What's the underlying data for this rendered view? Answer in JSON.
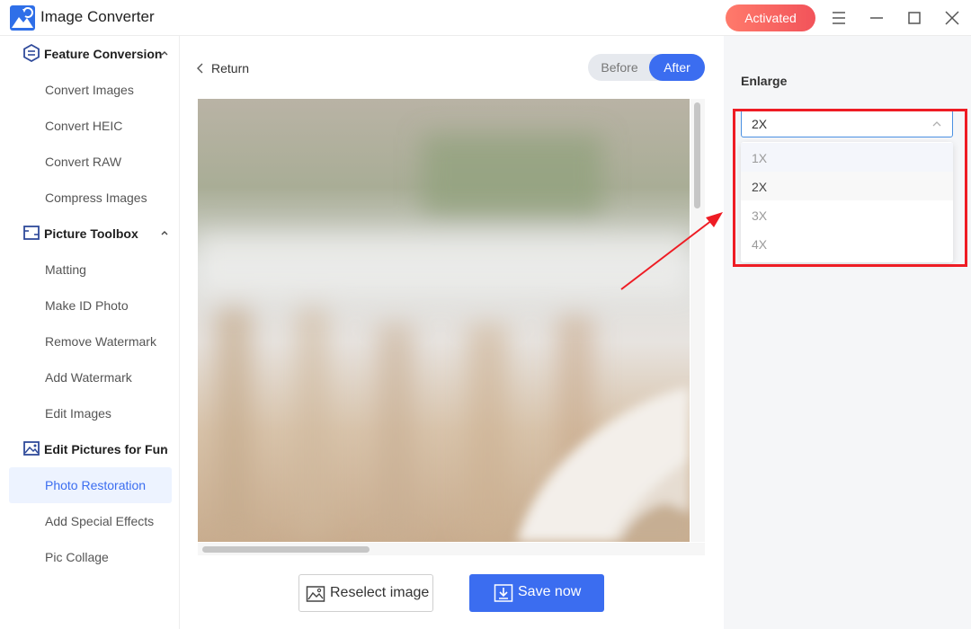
{
  "app": {
    "title": "Image Converter",
    "activated_label": "Activated"
  },
  "sidebar": {
    "sections": [
      {
        "label": "Feature Conversion",
        "items": [
          "Convert Images",
          "Convert HEIC",
          "Convert RAW",
          "Compress Images"
        ]
      },
      {
        "label": "Picture Toolbox",
        "items": [
          "Matting",
          "Make ID Photo",
          "Remove Watermark",
          "Add Watermark",
          "Edit Images"
        ]
      },
      {
        "label": "Edit Pictures for Fun",
        "items": [
          "Photo Restoration",
          "Add Special Effects",
          "Pic Collage"
        ]
      }
    ],
    "active_item": "Photo Restoration"
  },
  "main": {
    "return_label": "Return",
    "toggle": {
      "before": "Before",
      "after": "After",
      "selected": "After"
    },
    "reselect_label": "Reselect image",
    "save_label": "Save now"
  },
  "panel": {
    "enlarge_label": "Enlarge",
    "selected_value": "2X",
    "options": [
      "1X",
      "2X",
      "3X",
      "4X"
    ]
  },
  "colors": {
    "accent": "#3b6df0",
    "activated": "#f2535a",
    "annotation": "#ee1c24"
  }
}
